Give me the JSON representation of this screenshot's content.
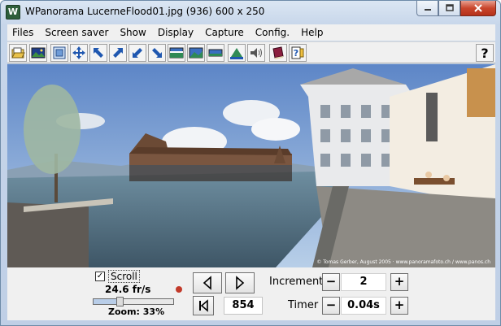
{
  "window": {
    "title": "WPanorama  LucerneFlood01.jpg  (936) 600 x 250",
    "app_icon_letter": "W"
  },
  "menu": [
    "Files",
    "Screen saver",
    "Show",
    "Display",
    "Capture",
    "Config.",
    "Help"
  ],
  "toolbar": {
    "help_label": "?"
  },
  "image": {
    "credit": "© Tomas Gerber, August 2005 · www.panoramafoto.ch / www.panos.ch"
  },
  "controls": {
    "scroll_label": "Scroll",
    "scroll_checked": "✓",
    "fps": "24.6 fr/s",
    "zoom_label": "Zoom: 33%",
    "zoom_level_percent": 33,
    "frame_value": "854",
    "increment_label": "Increment",
    "increment_value": "2",
    "timer_label": "Timer",
    "timer_value": "0.04s",
    "minus": "−",
    "plus": "+"
  },
  "colors": {
    "title_bar": "#c7d6ea",
    "close_button": "#c9462c",
    "panel_bg": "#f0f0f0",
    "sky": "#7ea3d6",
    "water": "#5f7f93"
  }
}
